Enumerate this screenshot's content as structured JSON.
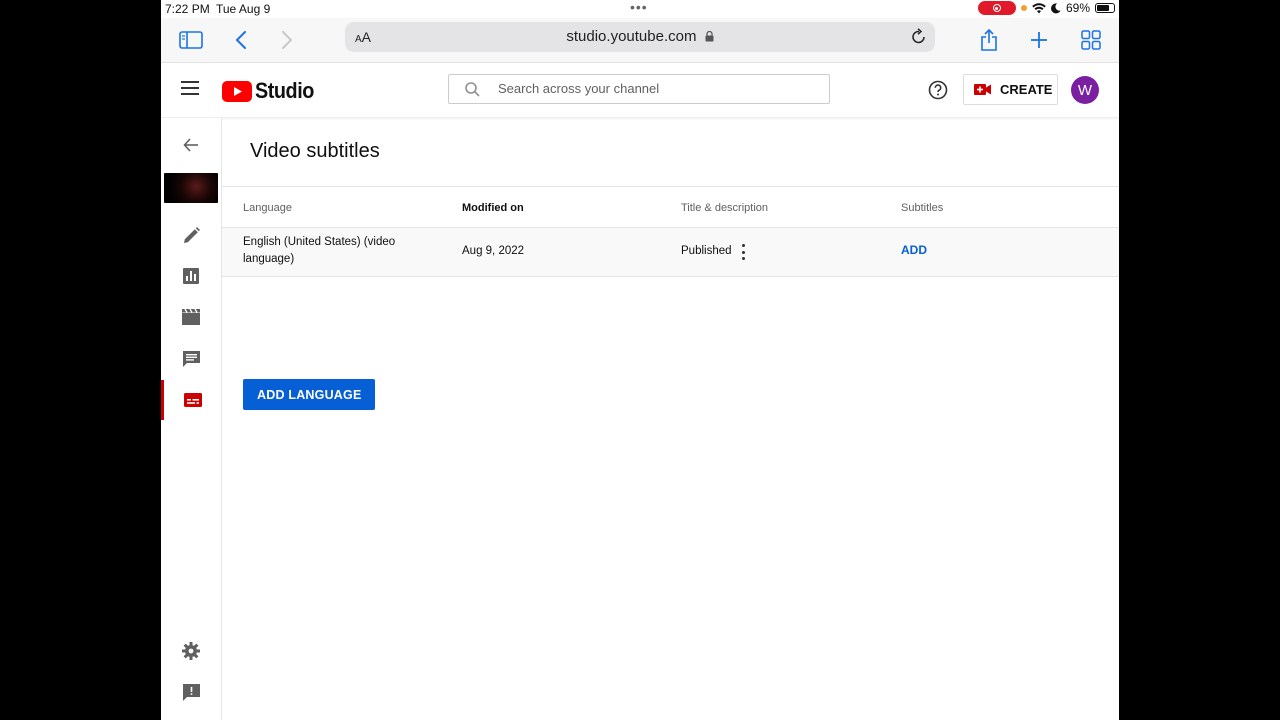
{
  "status_bar": {
    "time": "7:22 PM",
    "date": "Tue Aug 9",
    "battery": "69%"
  },
  "safari": {
    "aa_label": "AA",
    "url": "studio.youtube.com"
  },
  "header": {
    "logo_text": "Studio",
    "search_placeholder": "Search across your channel",
    "create_label": "CREATE",
    "avatar_initial": "W"
  },
  "page": {
    "title": "Video subtitles",
    "columns": [
      "Language",
      "Modified on",
      "Title & description",
      "Subtitles"
    ],
    "rows": [
      {
        "language_line1": "English (United States) (video",
        "language_line2": "language)",
        "modified_on": "Aug 9, 2022",
        "title_desc": "Published",
        "subtitles_action": "ADD"
      }
    ],
    "add_language_button": "ADD LANGUAGE"
  },
  "icons": {
    "rail": [
      "back-arrow-icon",
      "video-thumbnail",
      "pencil-icon",
      "analytics-icon",
      "clapperboard-icon",
      "comments-icon",
      "subtitles-icon",
      "settings-icon",
      "feedback-icon"
    ]
  },
  "colors": {
    "brand_red": "#cc0000",
    "link_blue": "#065fd4",
    "avatar_purple": "#7b1fa2"
  }
}
